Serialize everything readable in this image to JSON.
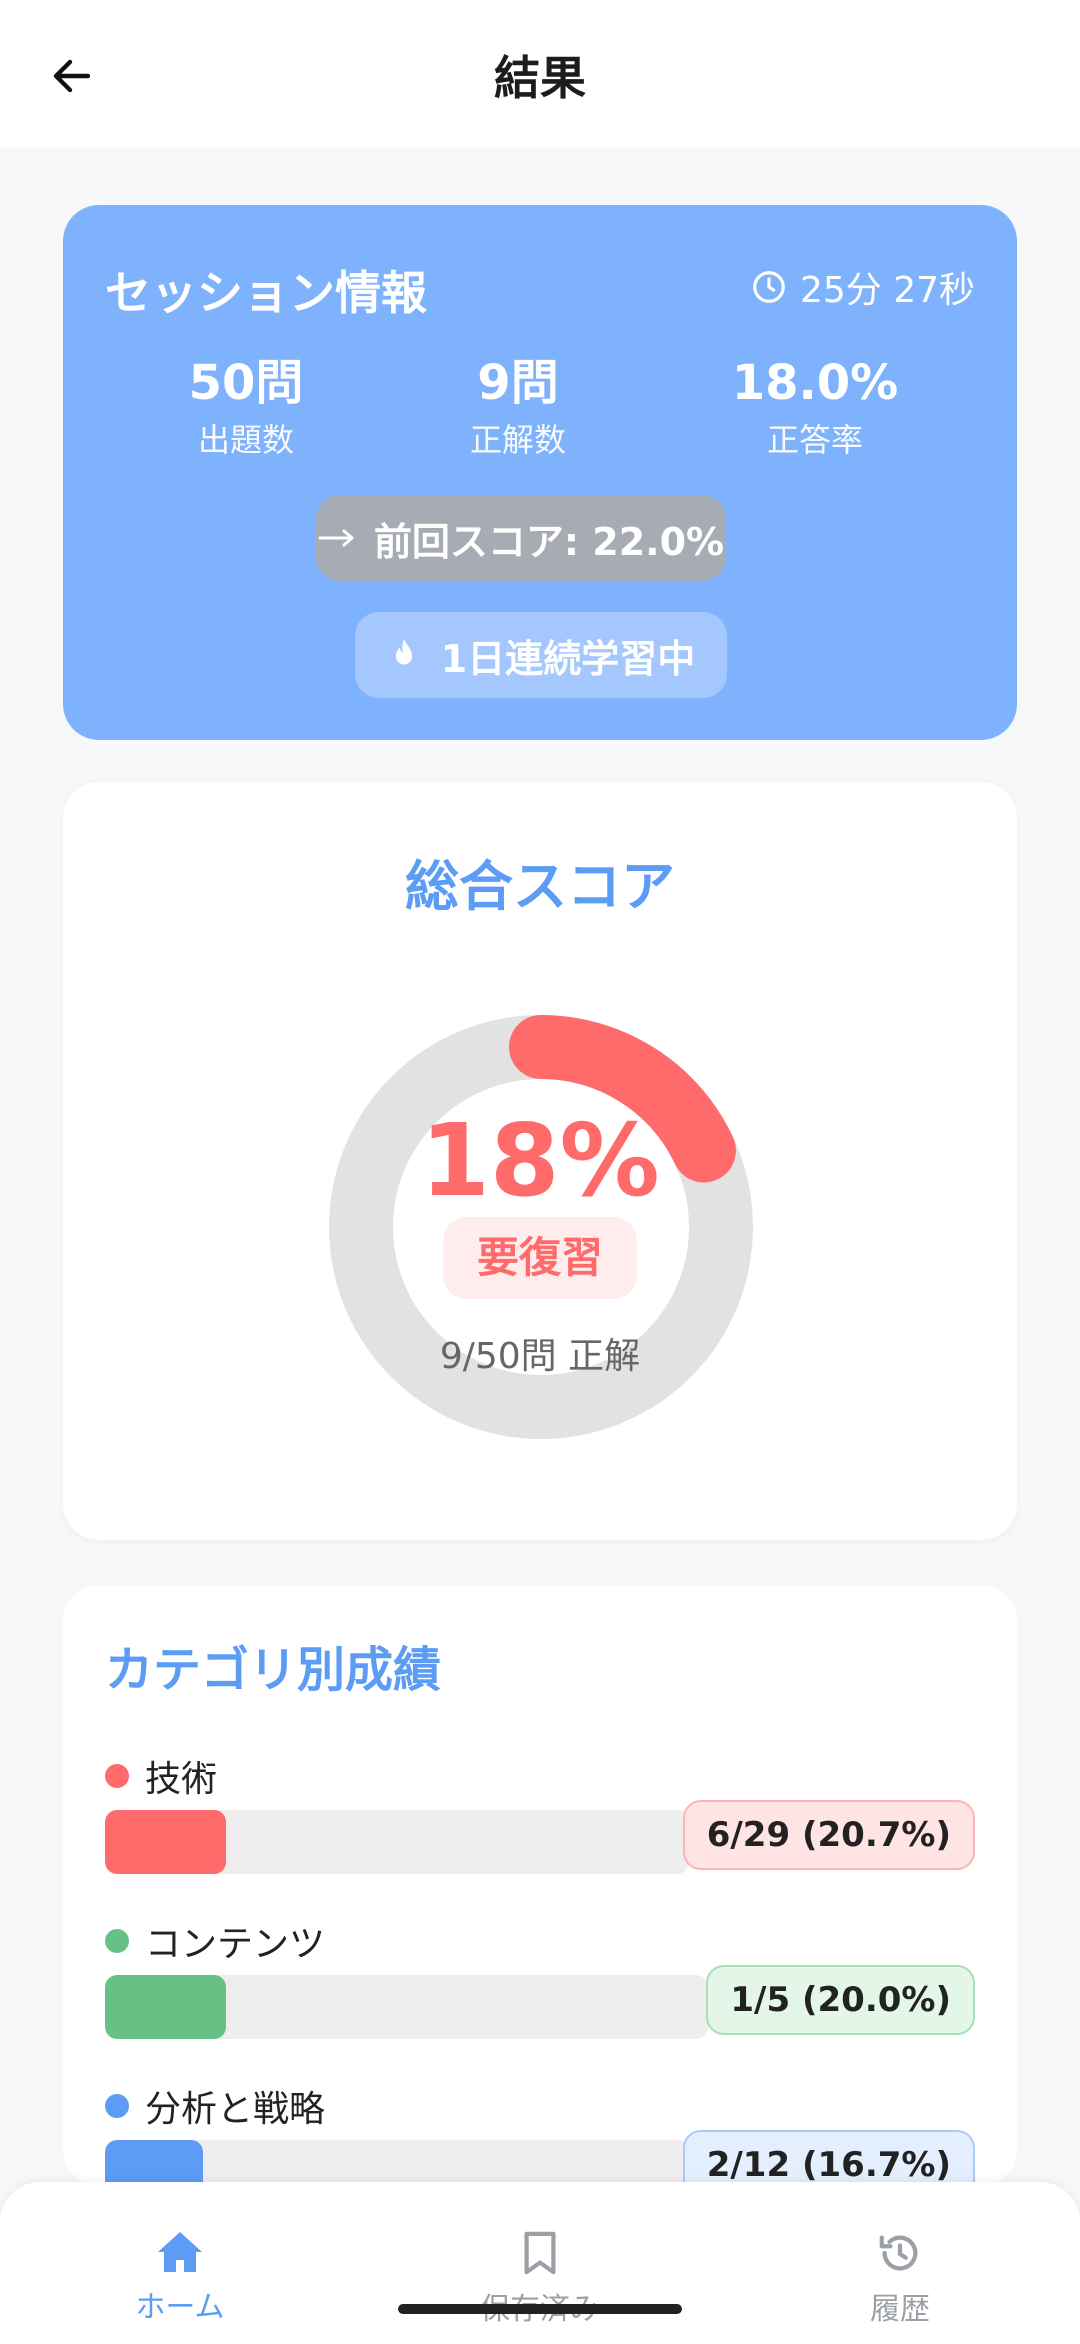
{
  "header": {
    "title": "結果"
  },
  "session": {
    "title": "セッション情報",
    "time": "25分 27秒",
    "stats": [
      {
        "value": "50問",
        "label": "出題数"
      },
      {
        "value": "9問",
        "label": "正解数"
      },
      {
        "value": "18.0%",
        "label": "正答率"
      }
    ],
    "previous_score": "前回スコア: 22.0%",
    "streak": "1日連続学習中"
  },
  "score": {
    "title": "総合スコア",
    "percent_text": "18%",
    "percent_value": 0.18,
    "badge": "要復習",
    "sub": "9/50問 正解",
    "ring_color": "#ff6b6b",
    "track_color": "#e2e2e2"
  },
  "categories": {
    "title": "カテゴリ別成績",
    "items": [
      {
        "name": "技術",
        "result": "6/29 (20.7%)",
        "ratio": 0.207,
        "color": "#ff6b6b",
        "pill_bg": "#ffe4e4",
        "pill_border": "#ffb3b3"
      },
      {
        "name": "コンテンツ",
        "result": "1/5 (20.0%)",
        "ratio": 0.2,
        "color": "#68c184",
        "pill_bg": "#e3f6e8",
        "pill_border": "#a7dfb6"
      },
      {
        "name": "分析と戦略",
        "result": "2/12 (16.7%)",
        "ratio": 0.167,
        "color": "#5c9cf5",
        "pill_bg": "#e3eefe",
        "pill_border": "#a9c9fb"
      }
    ]
  },
  "nav": {
    "home": "ホーム",
    "saved": "保存済み",
    "history": "履歴"
  }
}
